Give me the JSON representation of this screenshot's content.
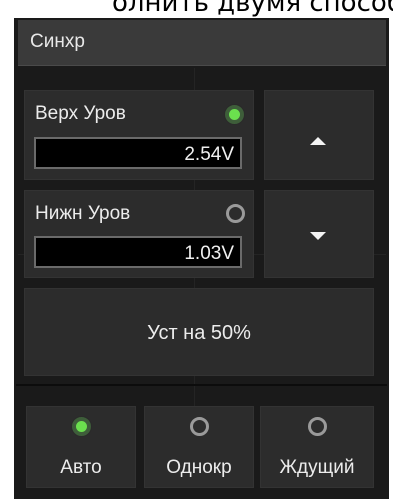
{
  "top_caption": "олнить двумя способами:",
  "panel": {
    "title": "Синхр",
    "upper_level": {
      "label": "Верх Уров",
      "value": "2.54V",
      "indicator_active": true
    },
    "lower_level": {
      "label": "Нижн Уров",
      "value": "1.03V",
      "indicator_active": false
    },
    "set_50_label": "Уст на 50%",
    "modes": [
      {
        "label": "Авто",
        "active": true
      },
      {
        "label": "Однокр",
        "active": false
      },
      {
        "label": "Ждущий",
        "active": false
      }
    ],
    "colors": {
      "panel_bg": "#1a1a1a",
      "tile_bg": "#2c2c2c",
      "title_bg": "#3a3a3a",
      "led_on": "#6be04e",
      "led_off": "#9a9a9a"
    }
  }
}
